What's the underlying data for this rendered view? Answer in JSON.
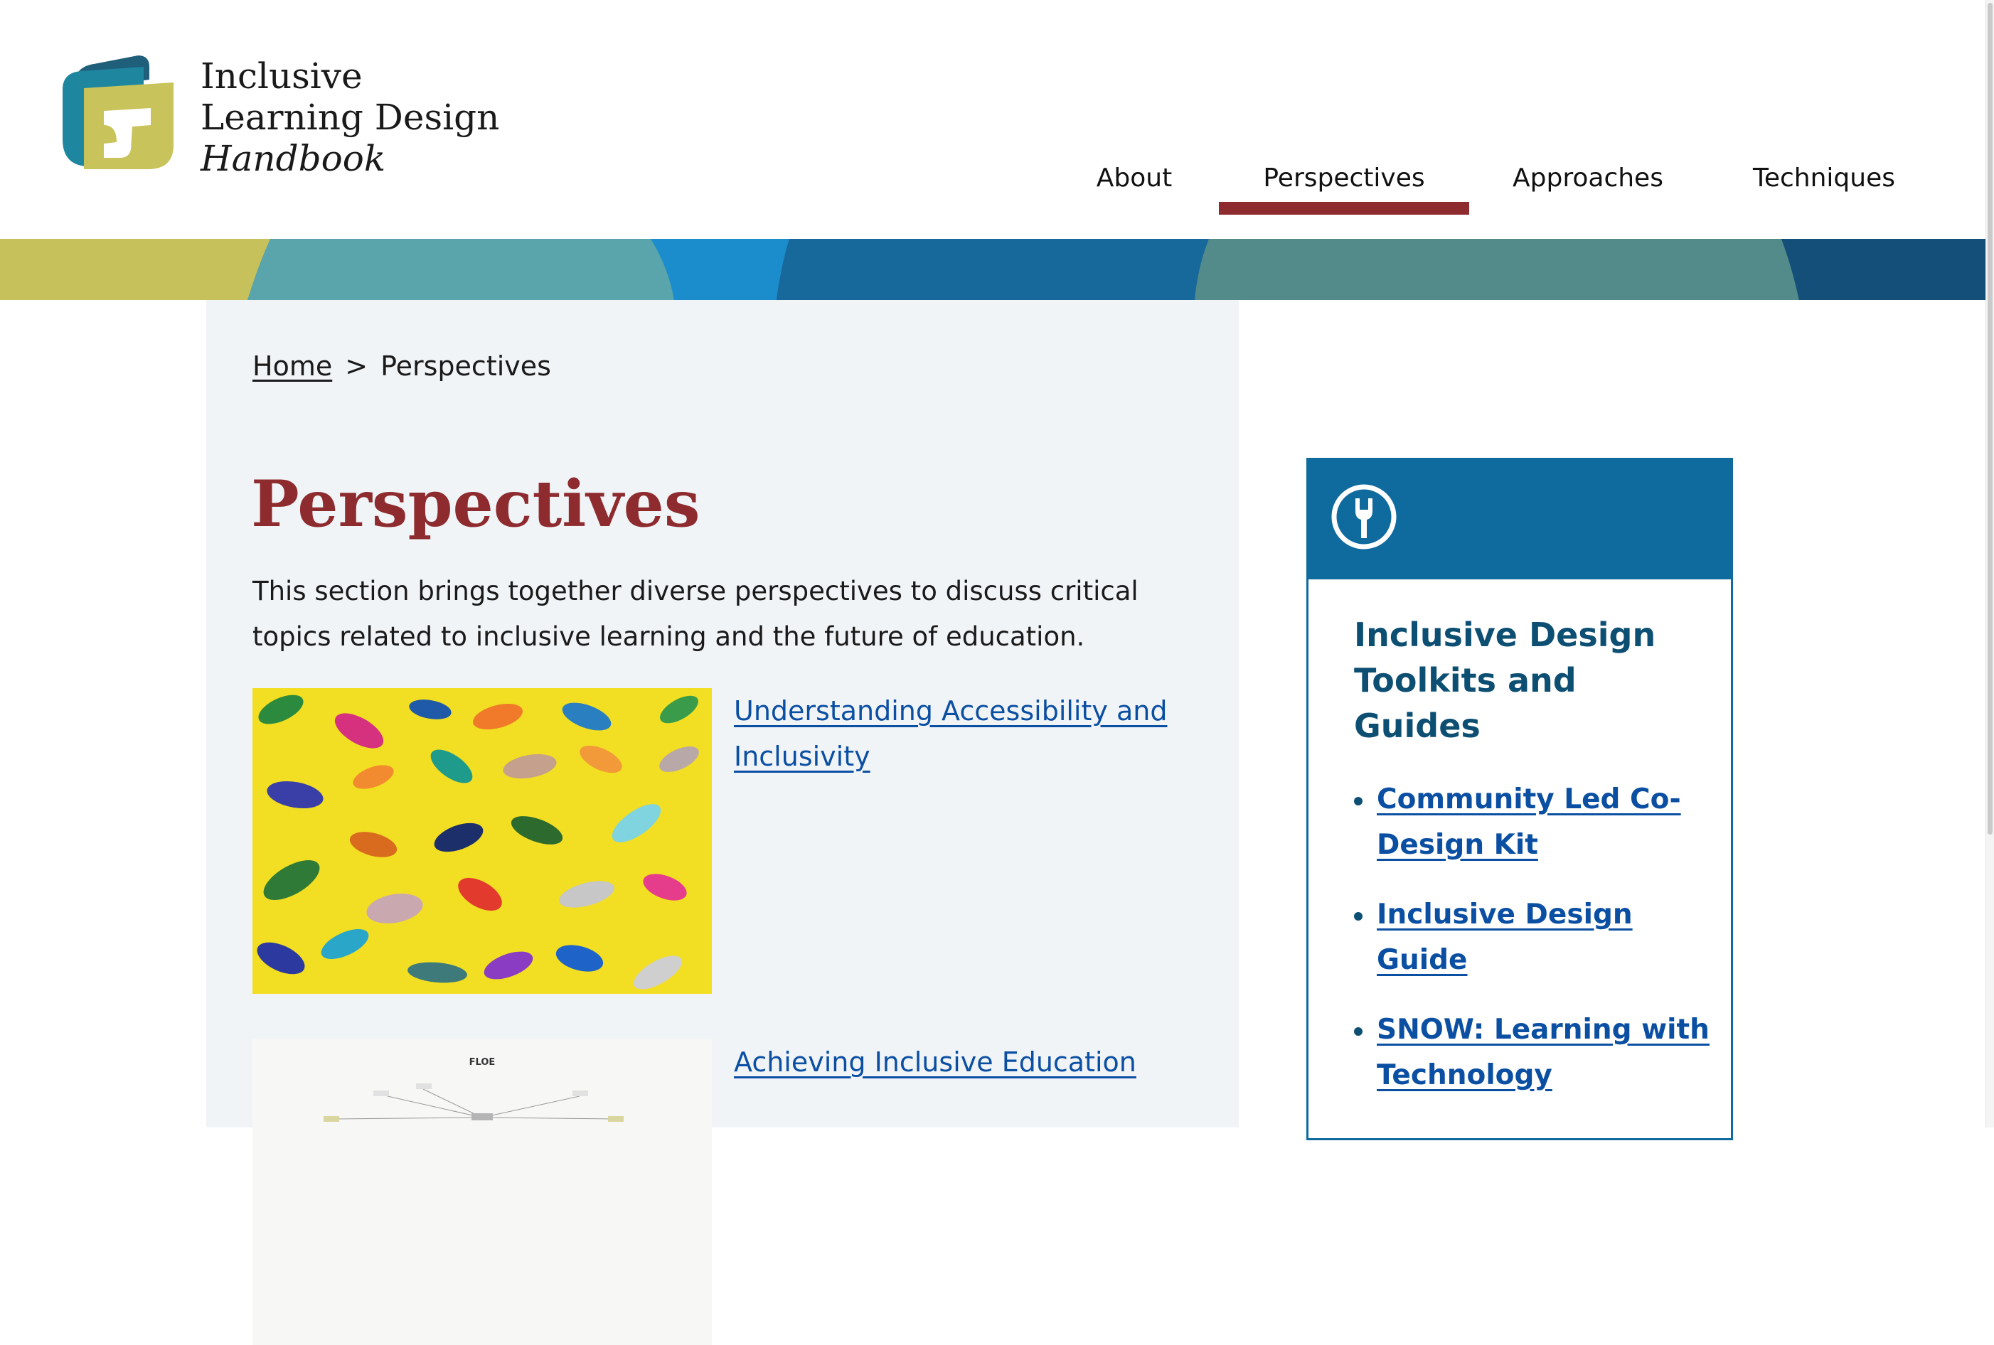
{
  "brand": {
    "line1": "Inclusive",
    "line2": "Learning Design",
    "line3": "Handbook"
  },
  "nav": {
    "items": [
      {
        "label": "About",
        "active": false
      },
      {
        "label": "Perspectives",
        "active": true
      },
      {
        "label": "Approaches",
        "active": false
      },
      {
        "label": "Techniques",
        "active": false
      }
    ]
  },
  "breadcrumb": {
    "home": "Home",
    "separator": ">",
    "current": "Perspectives"
  },
  "main": {
    "title": "Perspectives",
    "intro": "This section brings together diverse perspectives to discuss critical topics related to inclusive learning and the future of education.",
    "cards": [
      {
        "link": "Understanding Accessibility and Inclusivity",
        "image": "colorful-toy-animals-photo"
      },
      {
        "link": "Achieving Inclusive Education",
        "image": "concept-design-mindmap-photo",
        "image_text": "FLOE"
      }
    ]
  },
  "sidebar": {
    "icon": "wrench-icon",
    "title": "Inclusive Design Toolkits and Guides",
    "links": [
      "Community Led Co-Design Kit",
      "Inclusive Design Guide",
      "SNOW: Learning with Technology"
    ]
  },
  "colors": {
    "accent_red": "#8e2b2f",
    "link_blue": "#0b4fa3",
    "sidebar_blue": "#0f6a9e",
    "logo_yellow": "#c8c35a",
    "logo_teal": "#1f7c93"
  }
}
